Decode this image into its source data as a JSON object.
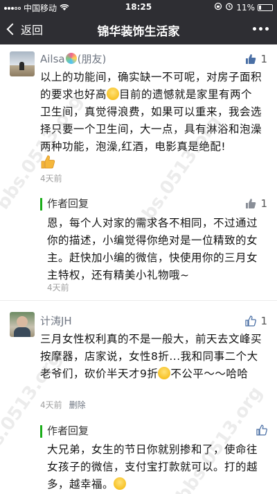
{
  "status_bar": {
    "carrier": "中国移动",
    "time": "18:25",
    "battery": "11%"
  },
  "nav": {
    "back_label": "返回",
    "title": "锦华装饰生活家"
  },
  "comments": [
    {
      "author": "Ailsa",
      "author_suffix": "(朋友)",
      "likes": "1",
      "text_part1": "以上的功能间，确实缺一不可呢，对房子面积的要求也好高",
      "text_part2": "目前的遗憾就是家里有两个卫生间，真觉得浪费，如果可以重来，我会选择只要一个卫生间，大一点，具有淋浴和泡澡两种功能，泡澡,红酒，电影真是绝配!",
      "time": "4天前",
      "reply": {
        "title": "作者回复",
        "likes": "1",
        "text": "恩，每个人对家的需求各不相同，不过通过你的描述，小编觉得你绝对是一位精致的女主。赶快加小编的微信，快使用你的三月女主特权，还有精美小礼物哦~",
        "time": "4天前"
      }
    },
    {
      "author": "计涛JH",
      "likes": "1",
      "text_part1": "三月女性权利真的不是一般大，前天去文峰买按摩器，店家说，女性8折...我和同事二个大老爷们，砍价半天才9折",
      "text_part2": "不公平～～哈哈",
      "time": "4天前",
      "delete_label": "删除",
      "reply": {
        "title": "作者回复",
        "text": "大兄弟，女生的节日你就别掺和了，使命往女孩子的微信，支付宝打款就可以。打的越多，越幸福。"
      }
    }
  ],
  "watermark": "bbs.0513.org"
}
